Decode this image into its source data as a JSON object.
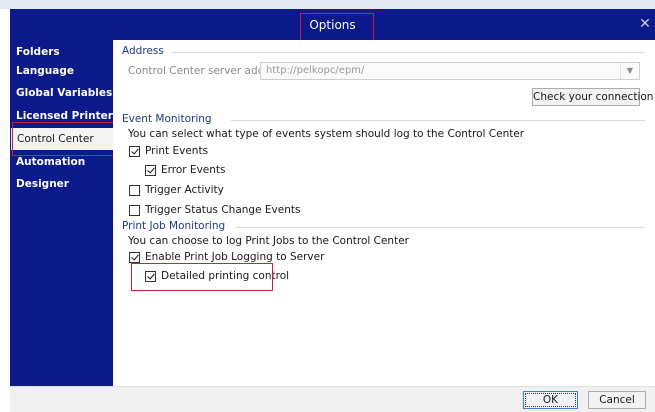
{
  "window": {
    "title": "Options",
    "close_glyph": "✕"
  },
  "sidebar": {
    "items": [
      {
        "label": "Folders",
        "selected": false
      },
      {
        "label": "Language",
        "selected": false
      },
      {
        "label": "Global Variables",
        "selected": false
      },
      {
        "label": "Licensed Printers",
        "selected": false
      },
      {
        "label": "Control Center",
        "selected": true
      },
      {
        "label": "Automation",
        "selected": false
      },
      {
        "label": "Designer",
        "selected": false
      }
    ]
  },
  "address": {
    "section_title": "Address",
    "server_label": "Control Center server address:",
    "server_placeholder": "http://pelkopc/epm/",
    "check_button": "Check your connection"
  },
  "event_monitoring": {
    "section_title": "Event Monitoring",
    "description": "You can select what type of events system should log to the Control Center",
    "print_events": {
      "label": "Print Events",
      "checked": true
    },
    "error_events": {
      "label": "Error Events",
      "checked": true
    },
    "trigger_activity": {
      "label": "Trigger Activity",
      "checked": false
    },
    "trigger_status": {
      "label": "Trigger Status Change Events",
      "checked": false
    }
  },
  "print_job_monitoring": {
    "section_title": "Print Job Monitoring",
    "description": "You can choose to log Print Jobs to the Control Center",
    "enable_logging": {
      "label": "Enable Print Job Logging to Server",
      "checked": true
    },
    "detailed_control": {
      "label": "Detailed printing control",
      "checked": true
    }
  },
  "footer": {
    "ok_label": "OK",
    "cancel_label": "Cancel"
  },
  "colors": {
    "accent": "#0c1a8c",
    "highlight": "#d0202a",
    "section_title": "#1b3a8a"
  }
}
